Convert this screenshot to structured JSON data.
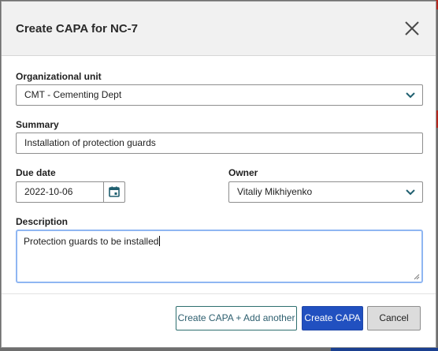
{
  "dialog": {
    "title": "Create CAPA for NC-7",
    "close_icon": "close-icon"
  },
  "fields": {
    "org_unit": {
      "label": "Organizational unit",
      "value": "CMT - Cementing Dept"
    },
    "summary": {
      "label": "Summary",
      "value": "Installation of protection guards"
    },
    "due_date": {
      "label": "Due date",
      "value": "2022-10-06",
      "icon": "calendar-icon"
    },
    "owner": {
      "label": "Owner",
      "value": "Vitaliy Mikhiyenko"
    },
    "description": {
      "label": "Description",
      "value": "Protection guards to be installed"
    }
  },
  "buttons": {
    "create_another": "Create CAPA + Add another",
    "create": "Create CAPA",
    "cancel": "Cancel"
  },
  "colors": {
    "primary": "#2150c0",
    "accent_teal": "#2e6f6f",
    "focus_border": "#8fb6f2"
  }
}
